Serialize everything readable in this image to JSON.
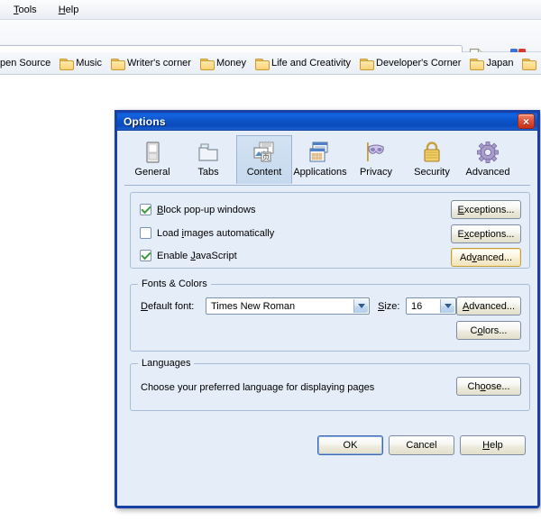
{
  "browser": {
    "menus": [
      {
        "label": "Tools",
        "mnemonic": "T"
      },
      {
        "label": "Help",
        "mnemonic": "H"
      }
    ],
    "urlbar": {
      "value": "",
      "placeholder": ""
    },
    "toolbar_icons": [
      {
        "name": "page-new-icon"
      },
      {
        "name": "page-dropdown-icon"
      },
      {
        "name": "google-search-icon"
      },
      {
        "name": "search-dropdown-icon"
      }
    ],
    "bookmarks": [
      {
        "label": "pen Source"
      },
      {
        "label": "Music"
      },
      {
        "label": "Writer's corner"
      },
      {
        "label": "Money"
      },
      {
        "label": "Life and Creativity"
      },
      {
        "label": "Developer's Corner"
      },
      {
        "label": "Japan"
      },
      {
        "label": ""
      }
    ]
  },
  "dialog": {
    "title": "Options",
    "close_label": "×",
    "tabs": [
      {
        "label": "General",
        "icon": "general-icon",
        "selected": false
      },
      {
        "label": "Tabs",
        "icon": "tabs-icon",
        "selected": false
      },
      {
        "label": "Content",
        "icon": "content-icon",
        "selected": true
      },
      {
        "label": "Applications",
        "icon": "applications-icon",
        "selected": false
      },
      {
        "label": "Privacy",
        "icon": "privacy-mask-icon",
        "selected": false
      },
      {
        "label": "Security",
        "icon": "security-lock-icon",
        "selected": false
      },
      {
        "label": "Advanced",
        "icon": "advanced-gear-icon",
        "selected": false
      }
    ],
    "content": {
      "checkboxes": [
        {
          "label": "Block pop-up windows",
          "mnemonic": "B",
          "checked": true,
          "button": {
            "label": "Exceptions...",
            "mnemonic": "E",
            "state": "normal"
          }
        },
        {
          "label": "Load images automatically",
          "mnemonic": "i",
          "checked": false,
          "button": {
            "label": "Exceptions...",
            "mnemonic": "x",
            "state": "normal"
          }
        },
        {
          "label": "Enable JavaScript",
          "mnemonic": "J",
          "checked": true,
          "button": {
            "label": "Advanced...",
            "mnemonic": "v",
            "state": "focused"
          }
        }
      ],
      "fonts": {
        "group_title": "Fonts & Colors",
        "font_label": "Default font:",
        "font_label_mnemonic": "D",
        "font_value": "Times New Roman",
        "size_label": "Size:",
        "size_label_mnemonic": "S",
        "size_value": "16",
        "advanced_button": {
          "label": "Advanced...",
          "mnemonic": "A"
        },
        "colors_button": {
          "label": "Colors...",
          "mnemonic": "o"
        }
      },
      "languages": {
        "group_title": "Languages",
        "description": "Choose your preferred language for displaying pages",
        "choose_button": {
          "label": "Choose...",
          "mnemonic": "o"
        }
      }
    },
    "buttons": [
      {
        "label": "OK",
        "mnemonic": "",
        "state": "default"
      },
      {
        "label": "Cancel",
        "mnemonic": "",
        "state": "normal"
      },
      {
        "label": "Help",
        "mnemonic": "H",
        "state": "normal"
      }
    ]
  },
  "colors": {
    "titlebar_blue": "#0d53c9",
    "dialog_border": "#1941a5",
    "dialog_bg": "#e4edf8",
    "close_red": "#c92f17",
    "check_green": "#3a9b3a",
    "focus_gold": "#c29f3a",
    "folder_yellow": "#fcd277"
  }
}
